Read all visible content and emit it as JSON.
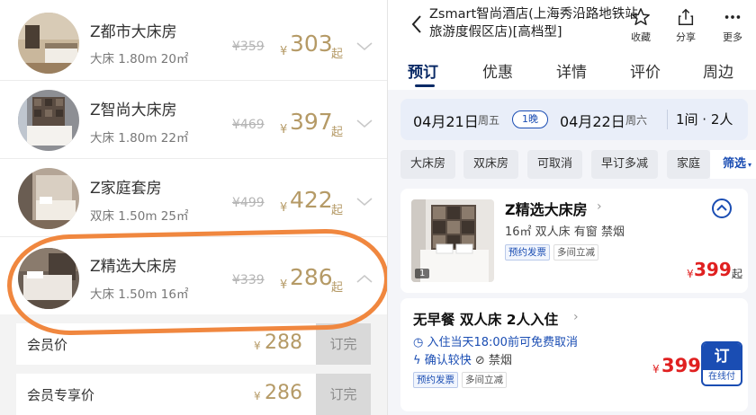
{
  "left": {
    "rooms": [
      {
        "name": "Z都市大床房",
        "spec": "大床 1.80m 20㎡",
        "old_price": "¥359",
        "currency": "¥",
        "price": "303",
        "suffix": "起",
        "expanded": false
      },
      {
        "name": "Z智尚大床房",
        "spec": "大床 1.80m 22㎡",
        "old_price": "¥469",
        "currency": "¥",
        "price": "397",
        "suffix": "起",
        "expanded": false
      },
      {
        "name": "Z家庭套房",
        "spec": "双床 1.50m 25㎡",
        "old_price": "¥499",
        "currency": "¥",
        "price": "422",
        "suffix": "起",
        "expanded": false
      },
      {
        "name": "Z精选大床房",
        "spec": "大床 1.50m 16㎡",
        "old_price": "¥339",
        "currency": "¥",
        "price": "286",
        "suffix": "起",
        "expanded": true
      }
    ],
    "rates": [
      {
        "label": "会员价",
        "currency": "¥",
        "price": "288",
        "status": "订完"
      },
      {
        "label": "会员专享价",
        "currency": "¥",
        "price": "286",
        "status": "订完"
      }
    ],
    "accent_color": "#b59a66",
    "highlight_color": "#f0873f"
  },
  "right": {
    "hotel_title": "Zsmart智尚酒店(上海秀沿路地铁站旅游度假区店)[高档型]",
    "toolbar": [
      {
        "icon": "star-icon",
        "label": "收藏"
      },
      {
        "icon": "share-icon",
        "label": "分享"
      },
      {
        "icon": "more-icon",
        "label": "更多"
      }
    ],
    "tabs": [
      "预订",
      "优惠",
      "详情",
      "评价",
      "周边"
    ],
    "active_tab": "预订",
    "dates": {
      "checkin": "04月21日",
      "checkin_weekday": "周五",
      "nights": "1晚",
      "checkout": "04月22日",
      "checkout_weekday": "周六",
      "rooms_guests": "1间 · 2人"
    },
    "chips": [
      "大床房",
      "双床房",
      "可取消",
      "早订多减",
      "家庭"
    ],
    "filter_label": "筛选",
    "room_card": {
      "name": "Z精选大床房",
      "spec": "16㎡ 双人床 有窗 禁烟",
      "tags": [
        "预约发票",
        "多间立减"
      ],
      "image_count": "1",
      "currency": "¥",
      "price": "399",
      "suffix": "起"
    },
    "rate_card": {
      "title": "无早餐 双人床 2人入住",
      "cancel_policy": "入住当天18:00前可免费取消",
      "confirm": "确认较快",
      "smoking": "禁烟",
      "tags": [
        "预约发票",
        "多间立减"
      ],
      "currency": "¥",
      "price": "399",
      "book_label": "订",
      "pay_label": "在线付"
    },
    "brand_color": "#1a4db3",
    "price_color": "#e02020"
  }
}
